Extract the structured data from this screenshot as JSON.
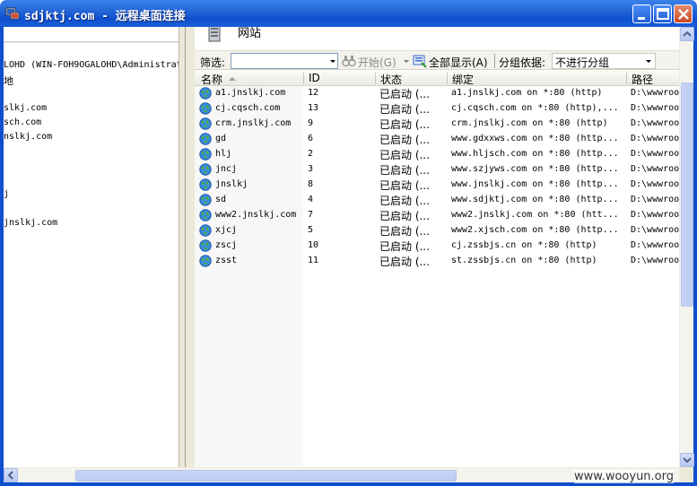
{
  "window": {
    "title": "sdjktj.com - 远程桌面连接",
    "minimize_label": "",
    "maximize_label": "",
    "close_label": ""
  },
  "left_pane": {
    "items": [
      "LOHD (WIN-FOH9OGALOHD\\Administrat",
      "地",
      "slkj.com",
      "sch.com",
      "nslkj.com",
      "j",
      "jnslkj.com"
    ]
  },
  "page_header": {
    "label": "网站"
  },
  "toolbar": {
    "filter_label": "筛选:",
    "filter_value": "",
    "start_label": "开始(G)",
    "show_all_label": "全部显示(A)",
    "group_by_label": "分组依据:",
    "group_by_value": "不进行分组"
  },
  "columns": {
    "name": "名称",
    "id": "ID",
    "status": "状态",
    "binding": "绑定",
    "path": "路径"
  },
  "sites": [
    {
      "name": "a1.jnslkj.com",
      "id": "12",
      "status": "已启动 (...",
      "binding": "a1.jnslkj.com on *:80 (http)",
      "path": "D:\\wwwroo"
    },
    {
      "name": "cj.cqsch.com",
      "id": "13",
      "status": "已启动 (...",
      "binding": "cj.cqsch.com on *:80 (http),...",
      "path": "D:\\wwwroo"
    },
    {
      "name": "crm.jnslkj.com",
      "id": "9",
      "status": "已启动 (...",
      "binding": "crm.jnslkj.com on *:80 (http)",
      "path": "D:\\wwwroo"
    },
    {
      "name": "gd",
      "id": "6",
      "status": "已启动 (...",
      "binding": "www.gdxxws.com on *:80 (http...",
      "path": "D:\\wwwroo"
    },
    {
      "name": "hlj",
      "id": "2",
      "status": "已启动 (...",
      "binding": "www.hljsch.com on *:80 (http...",
      "path": "D:\\wwwroo"
    },
    {
      "name": "jncj",
      "id": "3",
      "status": "已启动 (...",
      "binding": "www.szjyws.com on *:80 (http...",
      "path": "D:\\wwwroo"
    },
    {
      "name": "jnslkj",
      "id": "8",
      "status": "已启动 (...",
      "binding": "www.jnslkj.com on *:80 (http...",
      "path": "D:\\wwwroo"
    },
    {
      "name": "sd",
      "id": "4",
      "status": "已启动 (...",
      "binding": "www.sdjktj.com on *:80 (http...",
      "path": "D:\\wwwroo"
    },
    {
      "name": "www2.jnslkj.com",
      "id": "7",
      "status": "已启动 (...",
      "binding": "www2.jnslkj.com on *:80 (htt...",
      "path": "D:\\wwwroo"
    },
    {
      "name": "xjcj",
      "id": "5",
      "status": "已启动 (...",
      "binding": "www2.xjsch.com on *:80 (http...",
      "path": "D:\\wwwroo"
    },
    {
      "name": "zscj",
      "id": "10",
      "status": "已启动 (...",
      "binding": "cj.zssbjs.cn on *:80 (http)",
      "path": "D:\\wwwroo"
    },
    {
      "name": "zsst",
      "id": "11",
      "status": "已启动 (...",
      "binding": "st.zssbjs.cn on *:80 (http)",
      "path": "D:\\wwwroo"
    }
  ],
  "icons": {
    "app": "remote-desktop-icon",
    "site": "globe-icon",
    "header": "server-icon"
  },
  "colors": {
    "titlebar": "#0e4fce",
    "status_text": "#000000"
  },
  "watermark": "www.wooyun.org"
}
